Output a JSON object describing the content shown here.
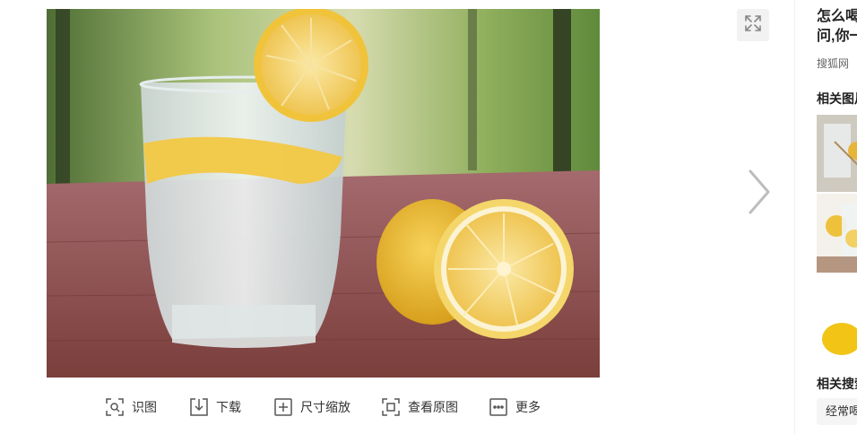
{
  "viewer": {
    "fullscreen_icon": "expand-icon",
    "next_icon": "chevron-right-icon"
  },
  "toolbar": {
    "items": [
      {
        "label": "识图",
        "icon": "scan-search-icon"
      },
      {
        "label": "下载",
        "icon": "download-icon"
      },
      {
        "label": "尺寸缩放",
        "icon": "plus-square-icon"
      },
      {
        "label": "查看原图",
        "icon": "view-original-icon"
      },
      {
        "label": "更多",
        "icon": "more-dots-icon"
      }
    ]
  },
  "sidebar": {
    "title_line1": "怎么喝",
    "title_line2": "问,你一",
    "source": "搜狐网",
    "related_images_heading": "相关图片",
    "related_search_heading": "相关搜索",
    "related_search_chip": "经常喝"
  },
  "colors": {
    "text": "#333333",
    "muted": "#666666",
    "icon": "#555555",
    "chip_bg": "#f5f5f5"
  }
}
